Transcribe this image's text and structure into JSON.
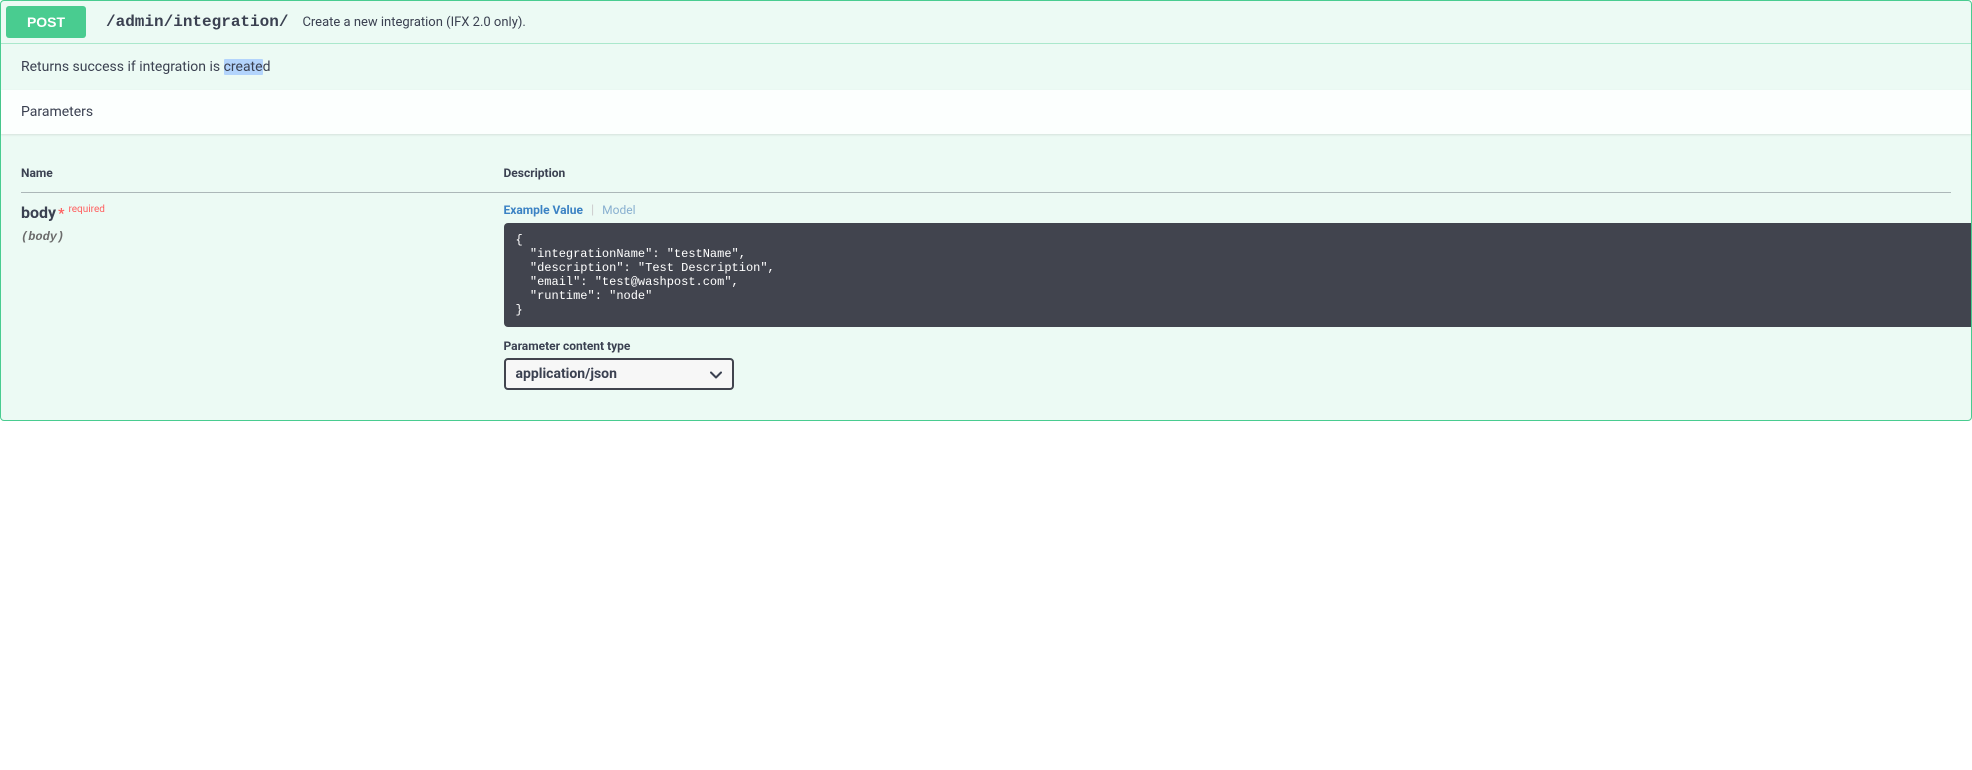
{
  "operation": {
    "method": "POST",
    "path": "/admin/integration/",
    "summary": "Create a new integration (IFX 2.0 only).",
    "description_pre": "Returns success if integration is ",
    "description_highlight": "create",
    "description_post": "d"
  },
  "sections": {
    "parameters_header": "Parameters"
  },
  "columns": {
    "name": "Name",
    "description": "Description"
  },
  "param": {
    "name": "body",
    "required_star": "*",
    "required_label": "required",
    "in": "(body)"
  },
  "tabs": {
    "example_value": "Example Value",
    "model": "Model"
  },
  "example_body": "{\n  \"integrationName\": \"testName\",\n  \"description\": \"Test Description\",\n  \"email\": \"test@washpost.com\",\n  \"runtime\": \"node\"\n}",
  "content_type": {
    "label": "Parameter content type",
    "selected": "application/json"
  }
}
